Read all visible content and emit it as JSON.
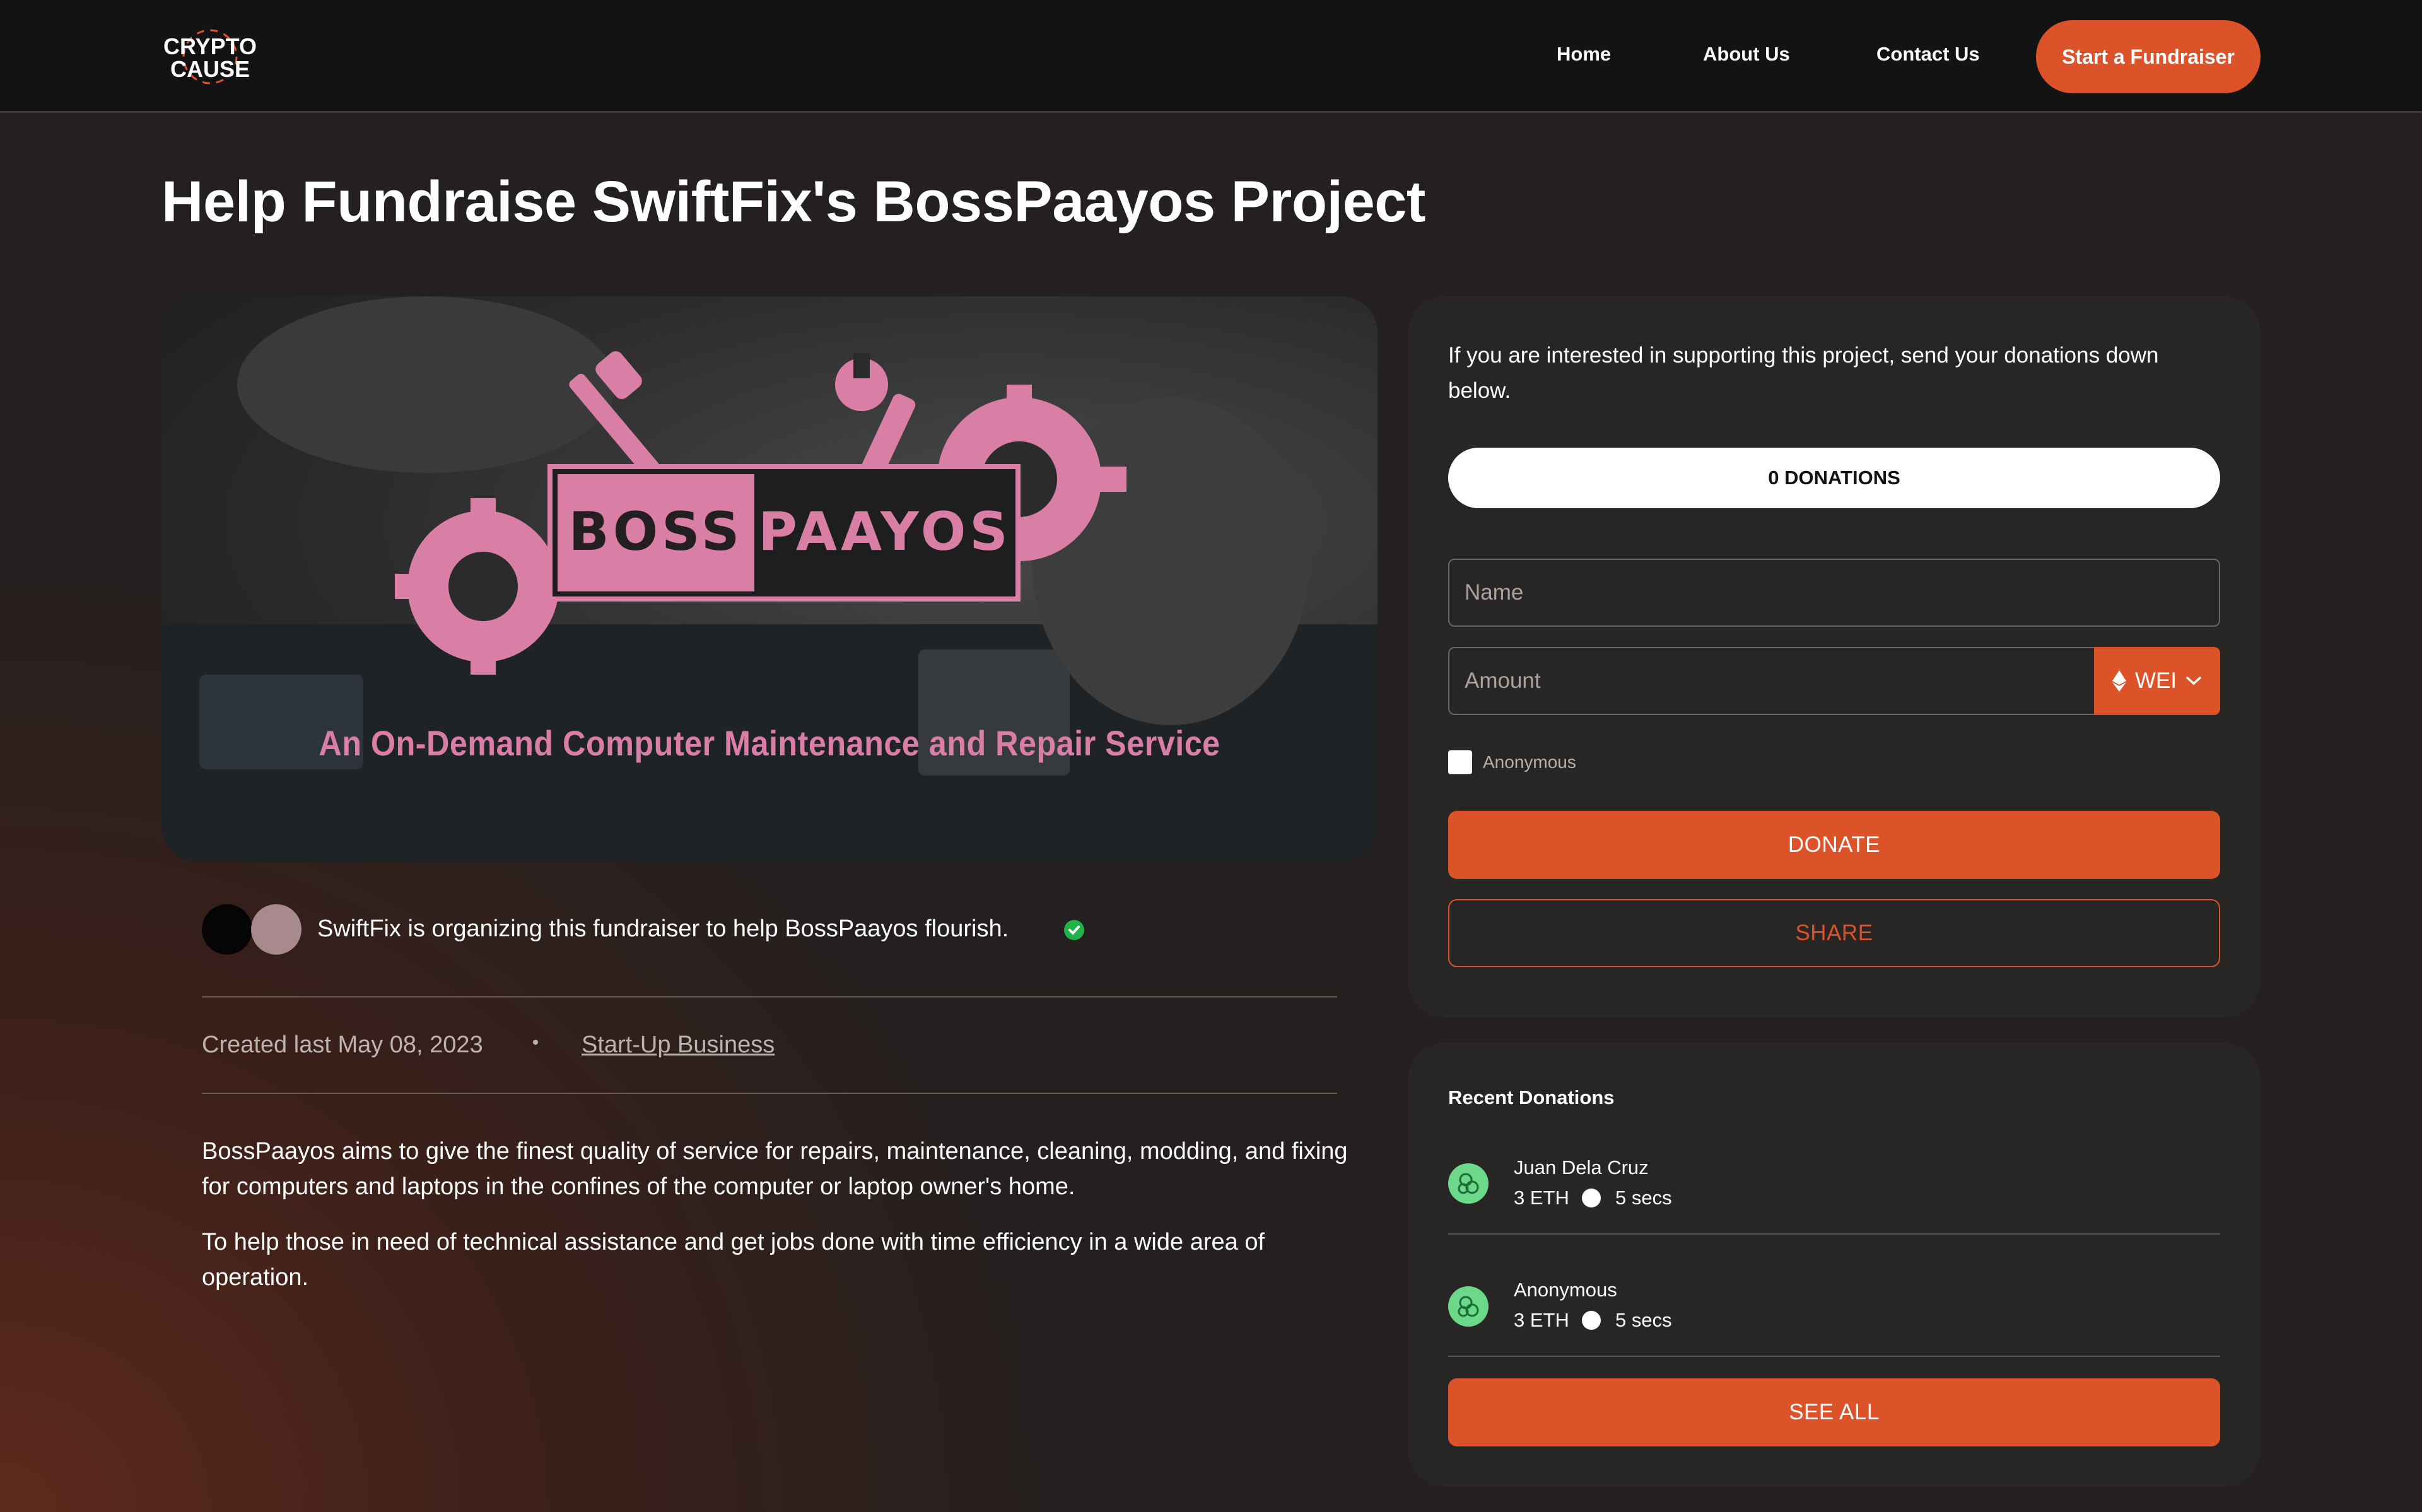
{
  "nav": {
    "logo_text_line1": "CRYPTO",
    "logo_text_line2": "CAUSE",
    "links": [
      "Home",
      "About Us",
      "Contact Us"
    ],
    "cta_label": "Start a Fundraiser"
  },
  "page": {
    "title": "Help Fundraise SwiftFix's BossPaayos Project"
  },
  "hero": {
    "logo_left": "BOSS",
    "logo_right": "PAAYOS",
    "tagline": "An On-Demand Computer Maintenance and Repair Service"
  },
  "organizer": {
    "text": "SwiftFix is organizing this fundraiser to help BossPaayos flourish."
  },
  "meta": {
    "created": "Created last May 08, 2023",
    "category": "Start-Up Business"
  },
  "description": [
    "BossPaayos aims to give the finest quality of service for repairs, maintenance, cleaning, modding, and fixing for computers and laptops in the confines of the computer or laptop owner's home.",
    "To help those in need of technical assistance and get jobs done with time efficiency in a wide area of operation."
  ],
  "donate_panel": {
    "intro": "If you are interested in supporting this project, send your donations down below.",
    "donations_count": "0 DONATIONS",
    "name_placeholder": "Name",
    "amount_placeholder": "Amount",
    "unit": "WEI",
    "anonymous_label": "Anonymous",
    "donate_label": "DONATE",
    "share_label": "SHARE"
  },
  "recent": {
    "title": "Recent Donations",
    "items": [
      {
        "name": "Juan Dela Cruz",
        "amount": "3 ETH",
        "time": "5 secs"
      },
      {
        "name": "Anonymous",
        "amount": "3 ETH",
        "time": "5 secs"
      }
    ],
    "see_all_label": "SEE ALL"
  },
  "colors": {
    "accent": "#dd5329",
    "brand_pink": "#d97ea5",
    "verified": "#21b24a",
    "donor_icon": "#6cd98a"
  },
  "icons": [
    "ethereum-icon",
    "chevron-down-icon",
    "verified-check-icon",
    "donor-icon"
  ]
}
